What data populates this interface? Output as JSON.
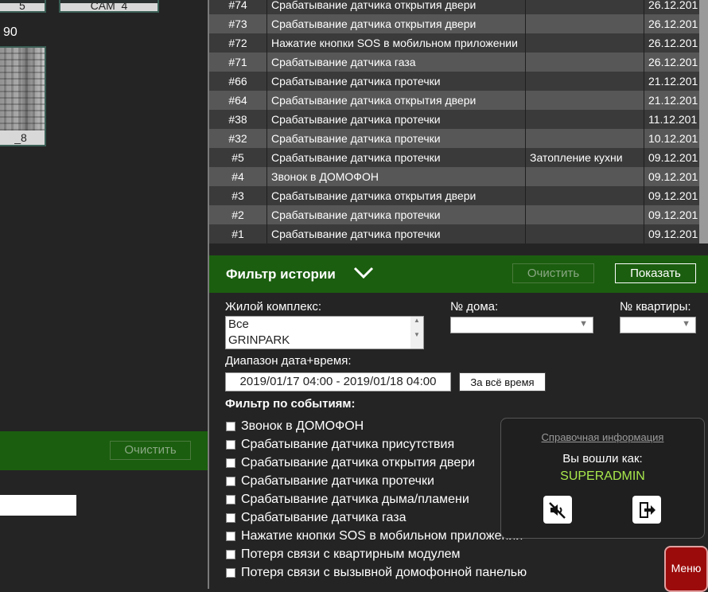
{
  "left_panel": {
    "cameras": [
      {
        "label": "_5"
      },
      {
        "label": "CAM_4"
      },
      {
        "label": "_8"
      }
    ],
    "number_text": "90",
    "clear_label": "Очистить"
  },
  "history_table": {
    "rows": [
      {
        "id": "#74",
        "event": "Срабатывание датчика открытия двери",
        "description": "",
        "date": "26.12.201"
      },
      {
        "id": "#73",
        "event": "Срабатывание датчика открытия двери",
        "description": "",
        "date": "26.12.201"
      },
      {
        "id": "#72",
        "event": "Нажатие кнопки SOS в мобильном приложении",
        "description": "",
        "date": "26.12.201"
      },
      {
        "id": "#71",
        "event": "Срабатывание датчика газа",
        "description": "",
        "date": "26.12.201"
      },
      {
        "id": "#66",
        "event": "Срабатывание датчика протечки",
        "description": "",
        "date": "21.12.201"
      },
      {
        "id": "#64",
        "event": "Срабатывание датчика открытия двери",
        "description": "",
        "date": "21.12.201"
      },
      {
        "id": "#38",
        "event": "Срабатывание датчика протечки",
        "description": "",
        "date": "11.12.201"
      },
      {
        "id": "#32",
        "event": "Срабатывание датчика протечки",
        "description": "",
        "date": "10.12.201"
      },
      {
        "id": "#5",
        "event": "Срабатывание датчика протечки",
        "description": "Затопление кухни",
        "date": "09.12.201"
      },
      {
        "id": "#4",
        "event": "Звонок в ДОМОФОН",
        "description": "",
        "date": "09.12.201"
      },
      {
        "id": "#3",
        "event": "Срабатывание датчика открытия двери",
        "description": "",
        "date": "09.12.201"
      },
      {
        "id": "#2",
        "event": "Срабатывание датчика протечки",
        "description": "",
        "date": "09.12.201"
      },
      {
        "id": "#1",
        "event": "Срабатывание датчика протечки",
        "description": "",
        "date": "09.12.201"
      }
    ]
  },
  "filter": {
    "title": "Фильтр истории",
    "clear_label": "Очистить",
    "show_label": "Показать",
    "complex_label": "Жилой комплекс:",
    "complex_options": [
      "Все",
      "GRINPARK"
    ],
    "house_label": "№ дома:",
    "house_value": "",
    "apartment_label": "№ квартиры:",
    "apartment_value": "",
    "range_label": "Диапазон дата+время:",
    "range_value": "2019/01/17 04:00 - 2019/01/18 04:00",
    "all_time_label": "За всё время",
    "events_label": "Фильтр по событиям:",
    "events": [
      {
        "label": "Звонок в ДОМОФОН",
        "checked": false
      },
      {
        "label": "Срабатывание датчика присутствия",
        "checked": false
      },
      {
        "label": "Срабатывание датчика открытия двери",
        "checked": false
      },
      {
        "label": "Срабатывание датчика протечки",
        "checked": false
      },
      {
        "label": "Срабатывание датчика дыма/пламени",
        "checked": false
      },
      {
        "label": "Срабатывание датчика газа",
        "checked": false
      },
      {
        "label": "Нажатие кнопки SOS в мобильном приложении",
        "checked": false
      },
      {
        "label": "Потеря связи с квартирным модулем",
        "checked": false
      },
      {
        "label": "Потеря связи с вызывной домофонной панелью",
        "checked": false
      }
    ]
  },
  "info_popup": {
    "link_label": "Справочная информация",
    "logged_in_label": "Вы вошли как:",
    "username": "SUPERADMIN",
    "mute_icon": "speaker-mute-icon",
    "logout_icon": "logout-icon"
  },
  "menu_label": "Меню",
  "colors": {
    "accent_green": "#1b5e0f",
    "username_green": "#a8e84c",
    "menu_red": "#9c0b0b"
  }
}
